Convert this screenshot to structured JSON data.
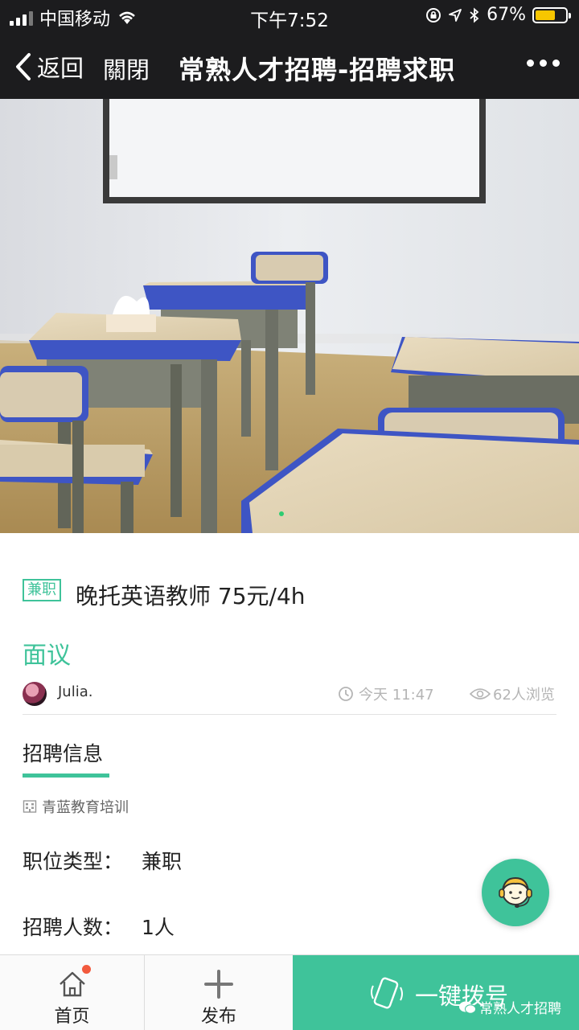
{
  "status_bar": {
    "carrier": "中国移动",
    "time": "下午7:52",
    "battery": "67%",
    "battery_level": 0.67
  },
  "nav": {
    "back_label": "返回",
    "close_label": "關閉",
    "title": "常熟人才招聘-招聘求职"
  },
  "job": {
    "tag": "兼职",
    "title": "晚托英语教师 75元/4h",
    "salary": "面议",
    "author": "Julia.",
    "time": "今天 11:47",
    "views": "62人浏览"
  },
  "section": {
    "title": "招聘信息",
    "company": "青蓝教育培训",
    "rows": [
      {
        "label": "职位类型：",
        "value": "兼职"
      },
      {
        "label": "招聘人数：",
        "value": "1人"
      }
    ]
  },
  "bottom_bar": {
    "home_label": "首页",
    "publish_label": "发布",
    "dial_label": "一键拨号",
    "watermark": "常熟人才招聘"
  },
  "colors": {
    "accent": "#3fc39a",
    "nav_bg": "#1c1c1e",
    "badge": "#f25a3d"
  },
  "icons": {
    "back": "chevron-left-icon",
    "more": "more-dots-icon",
    "clock": "clock-icon",
    "views": "eye-icon",
    "company": "building-icon",
    "service": "customer-service-icon",
    "home": "home-icon",
    "publish": "plus-icon",
    "dial": "phone-icon"
  }
}
